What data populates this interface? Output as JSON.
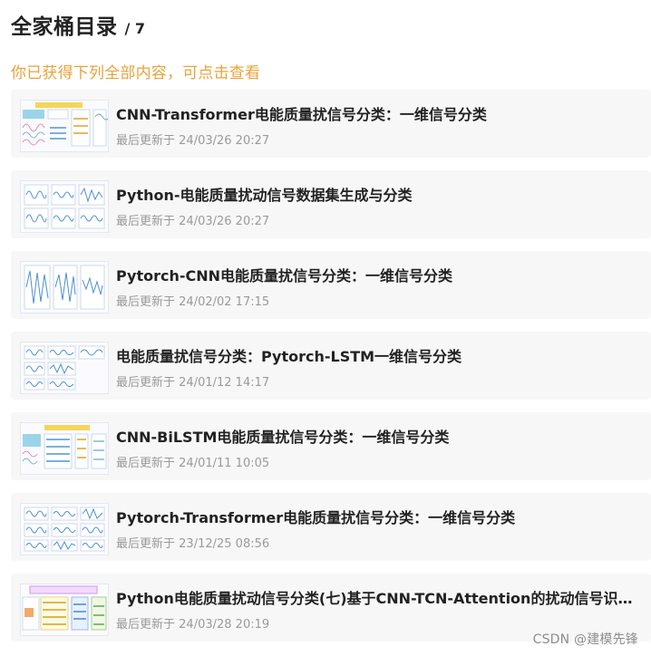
{
  "header": {
    "title": "全家桶目录",
    "count": "/ 7"
  },
  "subtitle": "你已获得下列全部内容，可点击查看",
  "items": [
    {
      "title": "CNN-Transformer电能质量扰信号分类：一维信号分类",
      "meta_prefix": "最后更新于",
      "date": "24/03/26 20:27"
    },
    {
      "title": "Python-电能质量扰动信号数据集生成与分类",
      "meta_prefix": "最后更新于",
      "date": "24/03/26 20:27"
    },
    {
      "title": "Pytorch-CNN电能质量扰信号分类：一维信号分类",
      "meta_prefix": "最后更新于",
      "date": "24/02/02 17:15"
    },
    {
      "title": "电能质量扰信号分类：Pytorch-LSTM一维信号分类",
      "meta_prefix": "最后更新于",
      "date": "24/01/12 14:17"
    },
    {
      "title": "CNN-BiLSTM电能质量扰信号分类：一维信号分类",
      "meta_prefix": "最后更新于",
      "date": "24/01/11 10:05"
    },
    {
      "title": "Pytorch-Transformer电能质量扰信号分类：一维信号分类",
      "meta_prefix": "最后更新于",
      "date": "23/12/25 08:56"
    },
    {
      "title": "Python电能质量扰动信号分类(七)基于CNN-TCN-Attention的扰动信号识别模型",
      "meta_prefix": "最后更新于",
      "date": "24/03/28 20:19"
    }
  ],
  "footer": {
    "watermark": "CSDN @建模先锋"
  },
  "colors": {
    "subtitle": "#e8a33a",
    "card_bg": "#f7f7f7"
  }
}
